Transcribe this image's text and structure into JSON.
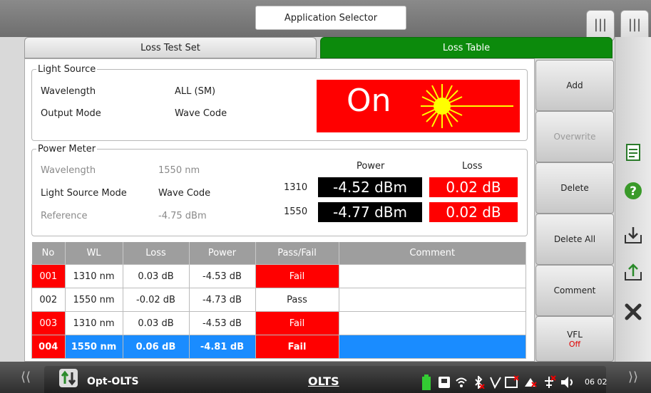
{
  "header": {
    "app_selector": "Application Selector"
  },
  "tabs": [
    {
      "label": "Loss Test Set"
    },
    {
      "label": "Loss Table"
    }
  ],
  "light_source": {
    "legend": "Light Source",
    "wavelength_label": "Wavelength",
    "wavelength_value": "ALL (SM)",
    "output_mode_label": "Output Mode",
    "output_mode_value": "Wave Code",
    "state": "On"
  },
  "power_meter": {
    "legend": "Power Meter",
    "wavelength_label": "Wavelength",
    "wavelength_value": "1550 nm",
    "ls_mode_label": "Light Source Mode",
    "ls_mode_value": "Wave Code",
    "reference_label": "Reference",
    "reference_value": "-4.75 dBm",
    "col_power": "Power",
    "col_loss": "Loss",
    "rows": [
      {
        "wl": "1310",
        "power": "-4.52 dBm",
        "loss": "0.02 dB"
      },
      {
        "wl": "1550",
        "power": "-4.77 dBm",
        "loss": "0.02 dB"
      }
    ]
  },
  "table": {
    "headers": [
      "No",
      "WL",
      "Loss",
      "Power",
      "Pass/Fail",
      "Comment"
    ],
    "rows": [
      {
        "no": "001",
        "wl": "1310 nm",
        "loss": "0.03 dB",
        "power": "-4.53 dB",
        "result": "Fail",
        "comment": ""
      },
      {
        "no": "002",
        "wl": "1550 nm",
        "loss": "-0.02 dB",
        "power": "-4.73 dB",
        "result": "Pass",
        "comment": ""
      },
      {
        "no": "003",
        "wl": "1310 nm",
        "loss": "0.03 dB",
        "power": "-4.53 dB",
        "result": "Fail",
        "comment": ""
      },
      {
        "no": "004",
        "wl": "1550 nm",
        "loss": "0.06 dB",
        "power": "-4.81 dB",
        "result": "Fail",
        "comment": ""
      }
    ]
  },
  "side_buttons": {
    "add": "Add",
    "overwrite": "Overwrite",
    "delete": "Delete",
    "delete_all": "Delete All",
    "comment": "Comment",
    "vfl": "VFL",
    "vfl_state": "Off"
  },
  "menu_tabs": {
    "menu1": "|||",
    "menu2": "|||"
  },
  "status_bar": {
    "app_name": "Opt-OLTS",
    "mode": "OLTS",
    "clock": "06 02"
  },
  "colors": {
    "fail": "#ff0000",
    "selected": "#1a8cff",
    "active_tab": "#0c8a0c"
  },
  "icons": [
    "report-icon",
    "help-icon",
    "save-icon",
    "load-icon",
    "close-icon",
    "battery-icon",
    "wifi-icon",
    "bluetooth-icon",
    "speaker-icon"
  ]
}
